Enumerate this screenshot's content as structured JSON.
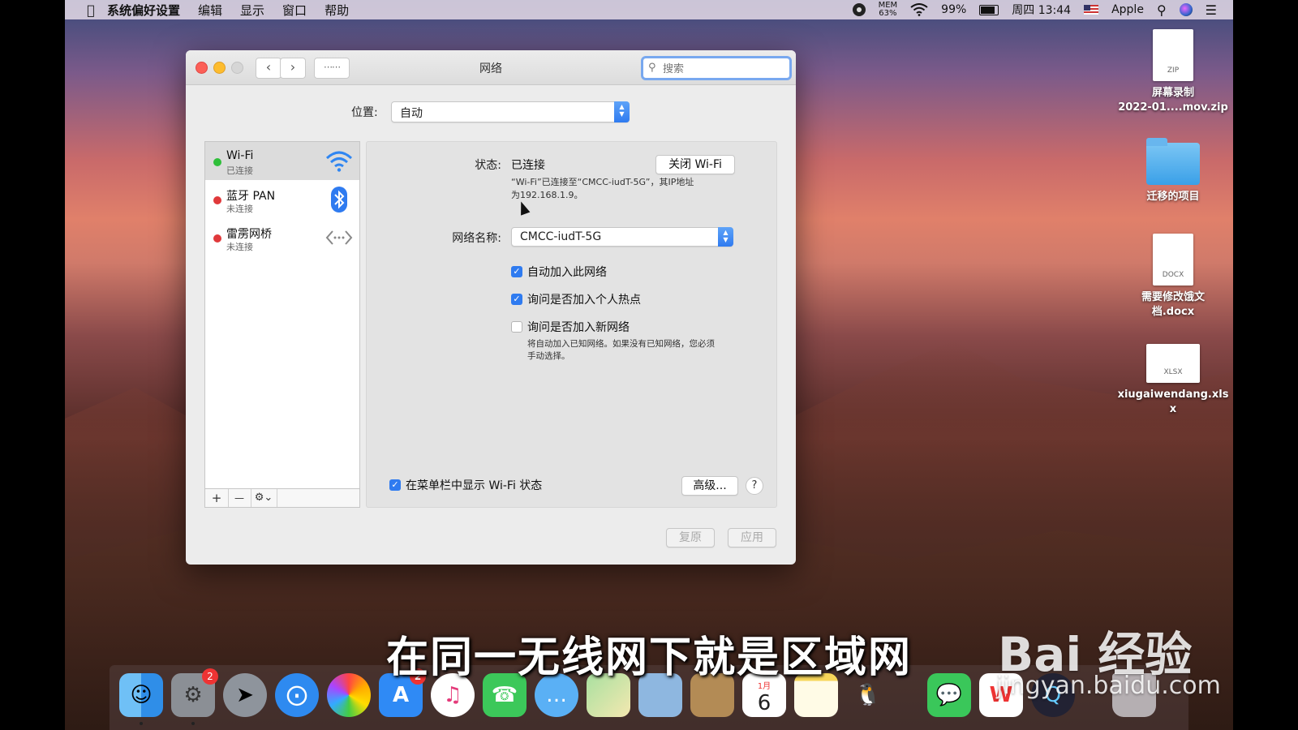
{
  "menubar": {
    "app_name": "系统偏好设置",
    "items": [
      "编辑",
      "显示",
      "窗口",
      "帮助"
    ],
    "mem_label": "MEM",
    "mem_value": "63%",
    "battery": "99%",
    "clock": "周四 13:44",
    "user": "Apple"
  },
  "window": {
    "title": "网络",
    "search_placeholder": "搜索",
    "location_label": "位置:",
    "location_value": "自动"
  },
  "services": [
    {
      "name": "Wi-Fi",
      "status": "已连接",
      "color": "#2fbf3a"
    },
    {
      "name": "蓝牙 PAN",
      "status": "未连接",
      "color": "#e0393b"
    },
    {
      "name": "雷雳网桥",
      "status": "未连接",
      "color": "#e0393b"
    }
  ],
  "sidebar_buttons": {
    "add": "+",
    "remove": "—",
    "gear": "⚙︎⌄"
  },
  "detail": {
    "status_label": "状态:",
    "status_value": "已连接",
    "toggle_button": "关闭 Wi-Fi",
    "description_line1": "“Wi-Fi”已连接至“CMCC-iudT-5G”，其IP地址",
    "description_line2": "为192.168.1.9。",
    "network_name_label": "网络名称:",
    "network_name_value": "CMCC-iudT-5G",
    "checkboxes": [
      {
        "label": "自动加入此网络",
        "checked": true
      },
      {
        "label": "询问是否加入个人热点",
        "checked": true
      },
      {
        "label": "询问是否加入新网络",
        "checked": false
      }
    ],
    "new_network_note_line1": "将自动加入已知网络。如果没有已知网络，您必须",
    "new_network_note_line2": "手动选择。",
    "show_in_menubar_label": "在菜单栏中显示 Wi-Fi 状态",
    "show_in_menubar_checked": true,
    "advanced_button": "高级...",
    "help_button": "?"
  },
  "footer": {
    "revert": "复原",
    "apply": "应用"
  },
  "desktop_icons": [
    {
      "label_line1": "屏幕录制",
      "label_line2": "2022-01....mov.zip",
      "type_badge": "ZIP"
    },
    {
      "label_line1": "迁移的项目",
      "label_line2": ""
    },
    {
      "label_line1": "需要修改饿文",
      "label_line2": "档.docx",
      "type_badge": "DOCX"
    },
    {
      "label_line1": "xiugaiwendang.xls",
      "label_line2": "x",
      "type_badge": "XLSX"
    }
  ],
  "dock": {
    "system_prefs_badge": "2",
    "app_store_badge": "2",
    "calendar_month": "1月",
    "calendar_day": "6"
  },
  "overlay": {
    "subtitle": "在同一无线网下就是区域网",
    "watermark": "Bai  经验",
    "watermark_url": "jingyan.baidu.com"
  }
}
